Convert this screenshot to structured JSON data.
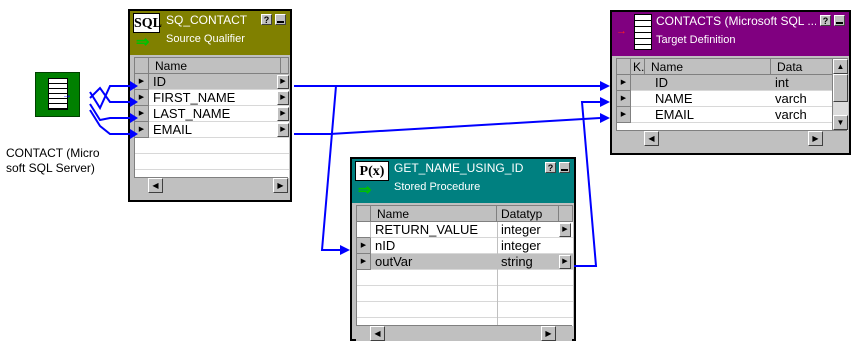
{
  "source": {
    "label_line1": "CONTACT (Micro",
    "label_line2": "soft SQL Server)",
    "icon_color": "#008000"
  },
  "sq_contact": {
    "badge": "SQL",
    "title": "SQ_CONTACT",
    "subtitle": "Source Qualifier",
    "header_color": "#808000",
    "col_name": "Name",
    "rows": [
      "ID",
      "FIRST_NAME",
      "LAST_NAME",
      "EMAIL"
    ],
    "help_btn": "?"
  },
  "target": {
    "title": "CONTACTS (Microsoft SQL ...",
    "subtitle": "Target Definition",
    "header_color": "#800080",
    "col_key": "K.",
    "col_name": "Name",
    "col_type": "Data",
    "rows": [
      {
        "name": "ID",
        "type": "int"
      },
      {
        "name": "NAME",
        "type": "varch"
      },
      {
        "name": "EMAIL",
        "type": "varch"
      }
    ],
    "help_btn": "?"
  },
  "sp": {
    "badge": "P(x)",
    "title": "GET_NAME_USING_ID",
    "subtitle": "Stored Procedure",
    "header_color": "#008080",
    "col_name": "Name",
    "col_type": "Datatyp",
    "rows": [
      {
        "name": "RETURN_VALUE",
        "type": "integer"
      },
      {
        "name": "nID",
        "type": "integer"
      },
      {
        "name": "outVar",
        "type": "string"
      }
    ],
    "help_btn": "?"
  },
  "colors": {
    "link": "#0000ff",
    "chrome": "#c0c0c0"
  }
}
